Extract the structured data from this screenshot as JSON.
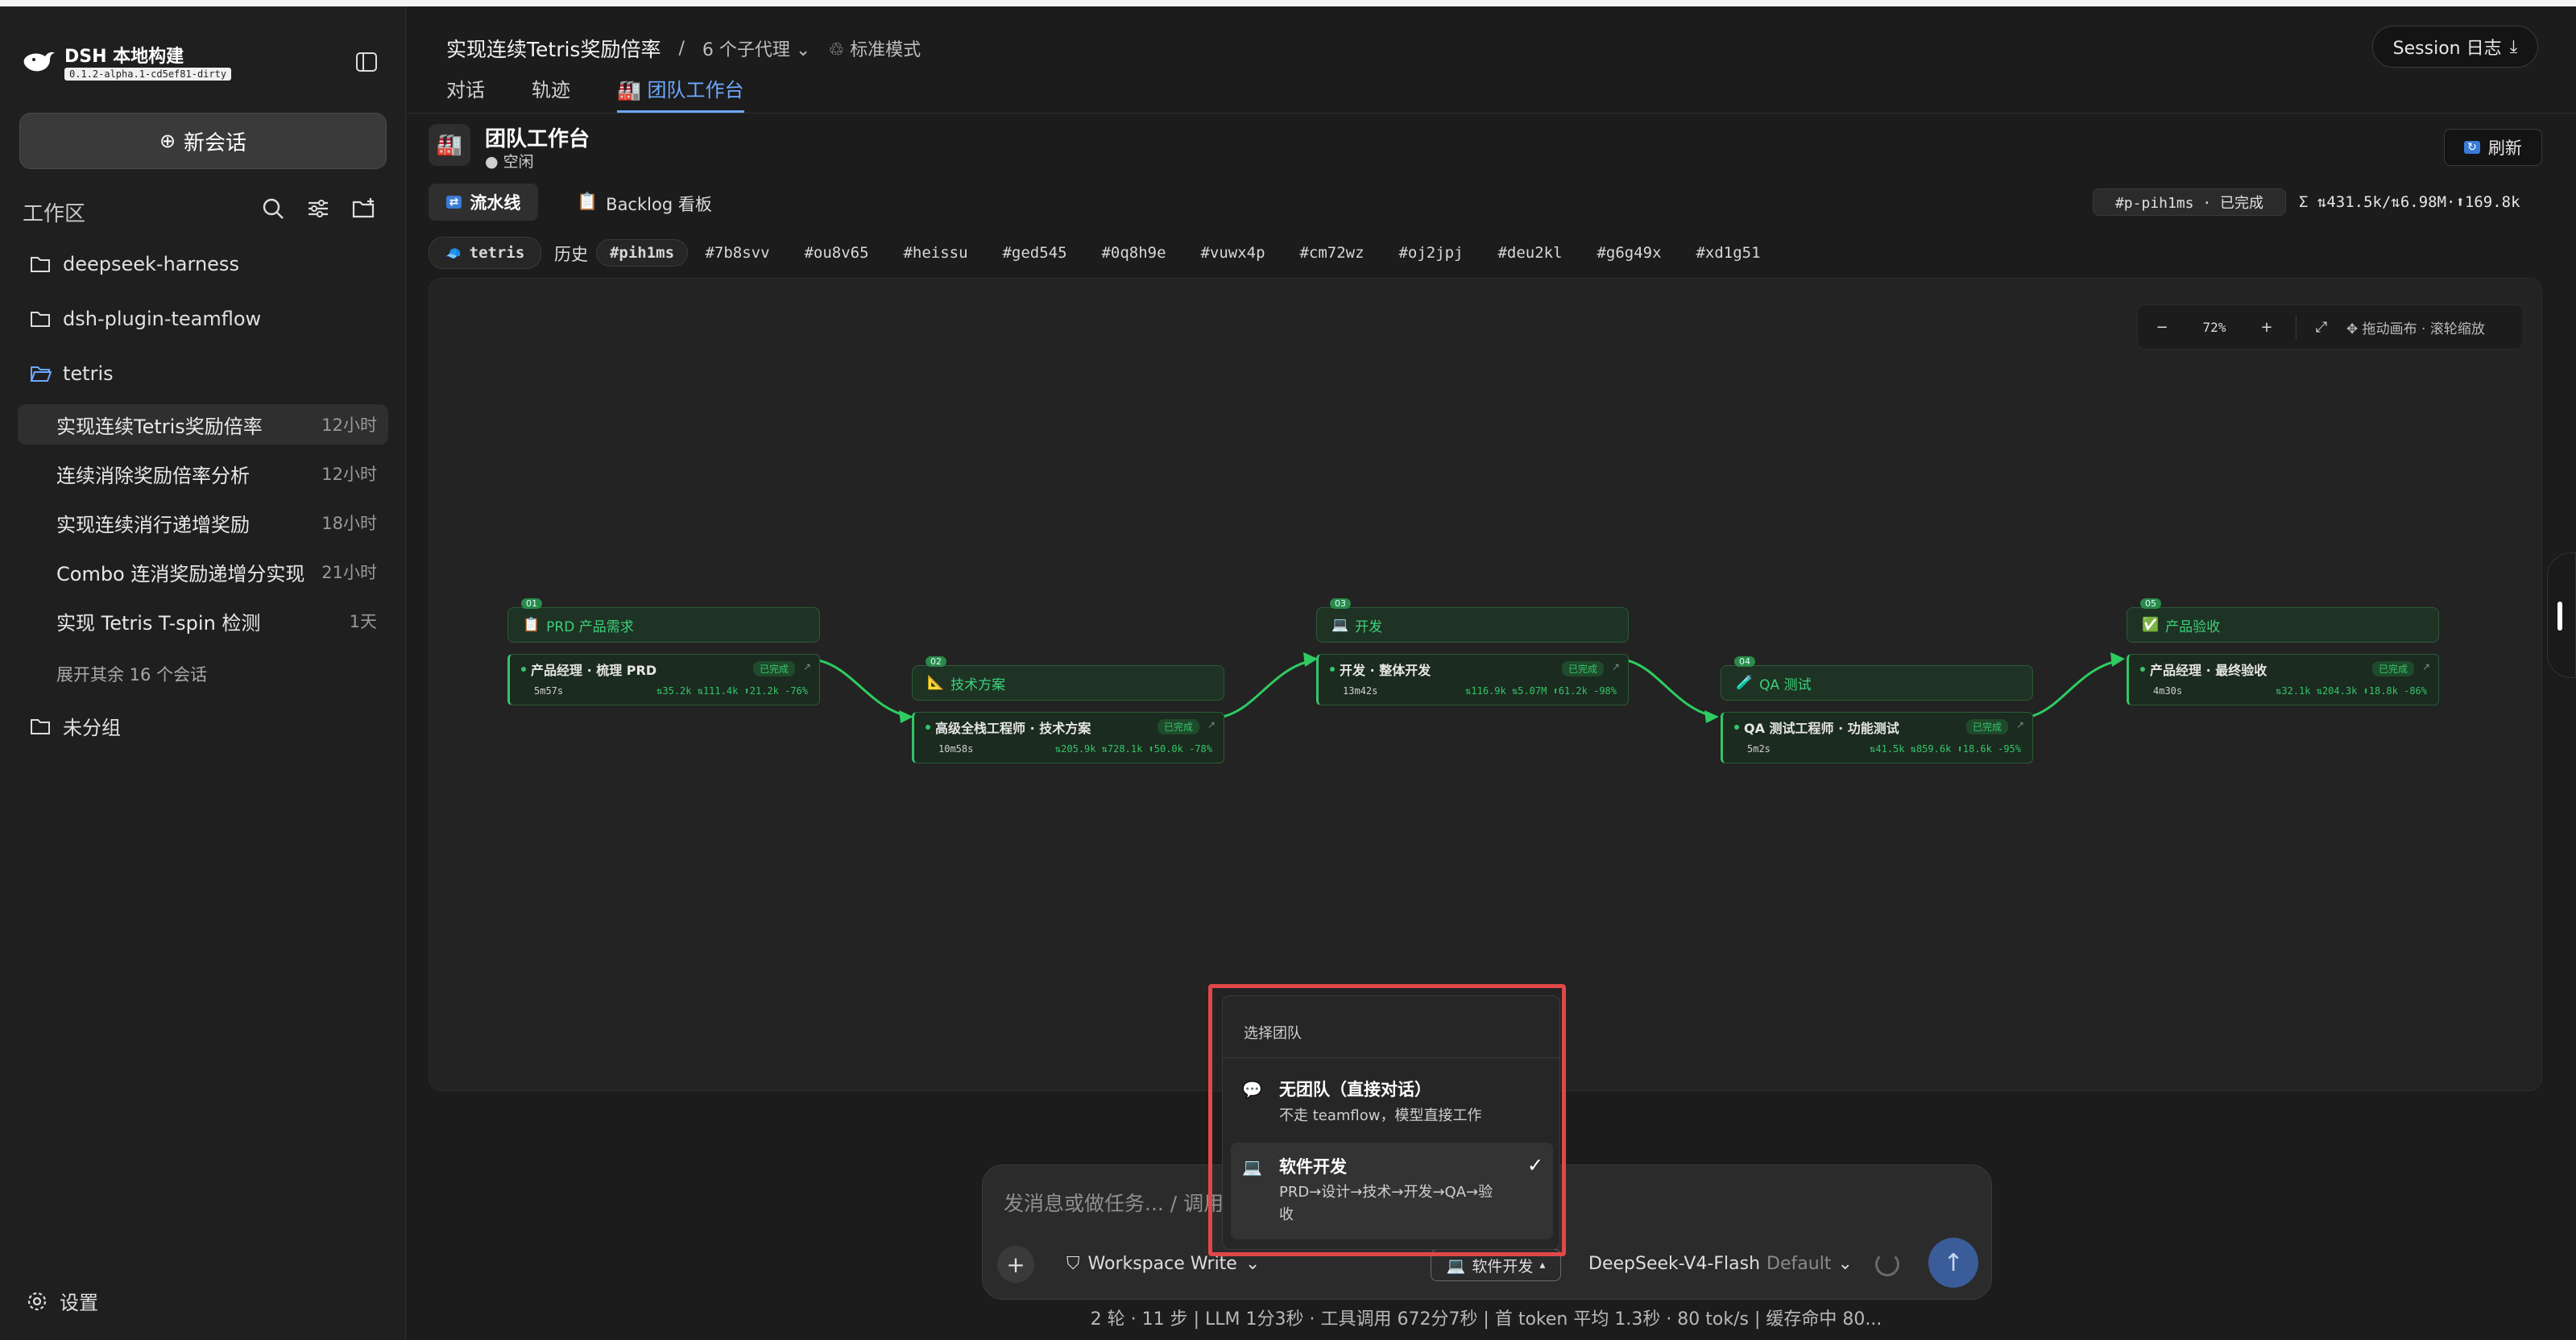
{
  "app": {
    "name": "DSH 本地构建",
    "version": "0.1.2-alpha.1-cd5ef81-dirty"
  },
  "sidebar": {
    "new_chat": "新会话",
    "workspace_label": "工作区",
    "folders": [
      {
        "name": "deepseek-harness"
      },
      {
        "name": "dsh-plugin-teamflow"
      },
      {
        "name": "tetris"
      }
    ],
    "sessions": [
      {
        "title": "实现连续Tetris奖励倍率",
        "time": "12小时",
        "active": true
      },
      {
        "title": "连续消除奖励倍率分析",
        "time": "12小时"
      },
      {
        "title": "实现连续消行递增奖励",
        "time": "18小时"
      },
      {
        "title": "Combo 连消奖励递增分实现",
        "time": "21小时"
      },
      {
        "title": "实现 Tetris T-spin 检测",
        "time": "1天"
      }
    ],
    "expand_more": "展开其余 16 个会话",
    "ungrouped": "未分组",
    "settings": "设置"
  },
  "header": {
    "title": "实现连续Tetris奖励倍率",
    "sep": "/",
    "agents": "6 个子代理",
    "mode": "标准模式",
    "session_log": "Session 日志",
    "tabs": [
      "对话",
      "轨迹",
      "团队工作台"
    ],
    "active_tab": 2
  },
  "workbench": {
    "title": "团队工作台",
    "status": "● 空闲",
    "refresh": "刷新",
    "view_tabs": [
      "流水线",
      "Backlog 看板"
    ],
    "run_badge": "#p-pih1ms · 已完成",
    "totals": "Σ ⇅431.5k/⇅6.98M·⬆169.8k",
    "team_chip": "tetris",
    "history_label": "历史",
    "history": [
      "#pih1ms",
      "#7b8svv",
      "#ou8v65",
      "#heissu",
      "#ged545",
      "#0q8h9e",
      "#vuwx4p",
      "#cm72wz",
      "#oj2jpj",
      "#deu2kl",
      "#g6g49x",
      "#xd1g51"
    ],
    "zoom": {
      "minus": "−",
      "level": "72%",
      "plus": "+",
      "fit": "⤢",
      "hint": "✥ 拖动画布 · 滚轮缩放"
    }
  },
  "pipeline": [
    {
      "num": "01",
      "stage": "PRD 产品需求",
      "icon": "📋",
      "agent": "产品经理 · 梳理 PRD",
      "status": "已完成",
      "duration": "5m57s",
      "tokens": "⇅35.2k ⇅111.4k ⬆21.2k -76%"
    },
    {
      "num": "02",
      "stage": "技术方案",
      "icon": "📐",
      "agent": "高级全栈工程师 · 技术方案",
      "status": "已完成",
      "duration": "10m58s",
      "tokens": "⇅205.9k ⇅728.1k ⬆50.0k -78%"
    },
    {
      "num": "03",
      "stage": "开发",
      "icon": "💻",
      "agent": "开发 · 整体开发",
      "status": "已完成",
      "duration": "13m42s",
      "tokens": "⇅116.9k ⇅5.07M ⬆61.2k -98%"
    },
    {
      "num": "04",
      "stage": "QA 测试",
      "icon": "🧪",
      "agent": "QA 测试工程师 · 功能测试",
      "status": "已完成",
      "duration": "5m2s",
      "tokens": "⇅41.5k ⇅859.6k ⬆18.6k -95%"
    },
    {
      "num": "05",
      "stage": "产品验收",
      "icon": "✅",
      "agent": "产品经理 · 最终验收",
      "status": "已完成",
      "duration": "4m30s",
      "tokens": "⇅32.1k ⇅204.3k ⬆18.8k -86%"
    }
  ],
  "team_popup": {
    "header": "选择团队",
    "options": [
      {
        "title": "无团队（直接对话）",
        "desc": "不走 teamflow，模型直接工作",
        "selected": false
      },
      {
        "title": "软件开发",
        "desc": "PRD→设计→技术→开发→QA→验收",
        "selected": true
      }
    ]
  },
  "composer": {
    "placeholder": "发消息或做任务... / 调用技",
    "permission": "Workspace Write",
    "team": "软件开发",
    "model": "DeepSeek-V4-Flash",
    "model_tag": "Default"
  },
  "status_bar": "2 轮 · 11 步  |  LLM 1分3秒 · 工具调用 672分7秒  |  首 token 平均 1.3秒 · 80 tok/s  |  缓存命中 80...",
  "colors": {
    "accent": "#6ea8ff",
    "success": "#35c46a",
    "highlight_border": "#e04848",
    "send_button": "#3a5d9a"
  }
}
